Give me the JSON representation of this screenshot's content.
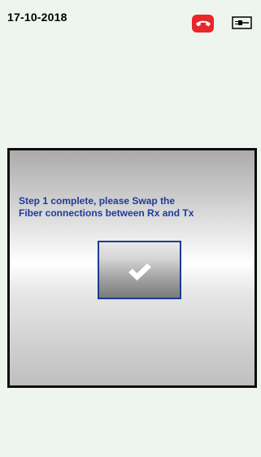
{
  "status_bar": {
    "date": "17-10-2018",
    "call_icon": "end-call-icon",
    "call_icon_color": "#e8262b",
    "power_icon": "power-plug-icon"
  },
  "dialog": {
    "message_lines": [
      "Step 1 complete, please Swap the",
      "Fiber connections between Rx and Tx"
    ],
    "message_color": "#1f3a9a",
    "button_icon": "checkmark-icon",
    "button_border_color": "#1c3c8c"
  },
  "colors": {
    "background": "#eef5ee"
  }
}
